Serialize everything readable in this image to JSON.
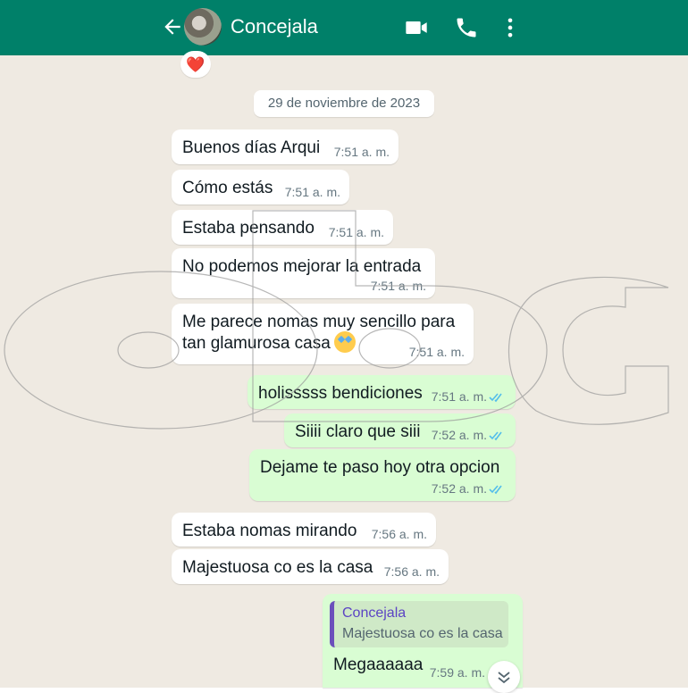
{
  "header": {
    "contact_name": "Concejala",
    "colors": {
      "bar": "#008069",
      "text": "#ffffff"
    },
    "icons": [
      "back-arrow-icon",
      "video-call-icon",
      "voice-call-icon",
      "more-options-icon"
    ]
  },
  "date_separator": "29 de noviembre de 2023",
  "reaction": "❤️",
  "messages": [
    {
      "text": "Buenos días Arqui",
      "time": "7:51 a. m."
    },
    {
      "text": "Cómo estás",
      "time": "7:51 a. m."
    },
    {
      "text": "Estaba pensando",
      "time": "7:51 a. m."
    },
    {
      "text": "No podemos mejorar la entrada",
      "time": "7:51 a. m."
    },
    {
      "text_line1": "Me parece nomas muy sencillo para",
      "text_line2": "tan glamurosa casa",
      "time": "7:51 a. m."
    },
    {
      "text": "holisssss bendiciones",
      "time": "7:51 a. m."
    },
    {
      "text": "Siiii claro que siii",
      "time": "7:52 a. m."
    },
    {
      "text": "Dejame te paso hoy otra opcion",
      "time": "7:52 a. m."
    },
    {
      "text": "Estaba nomas mirando",
      "time": "7:56 a. m."
    },
    {
      "text": "Majestuosa co es la casa",
      "time": "7:56 a. m."
    },
    {
      "quote_author": "Concejala",
      "quote_text": "Majestuosa co es la casa",
      "text": "Megaaaaaa",
      "time": "7:59 a. m."
    }
  ],
  "theme": {
    "incoming_bubble": "#ffffff",
    "outgoing_bubble": "#d9fdd3",
    "chat_background": "#efeae2",
    "read_ticks": "#53bdeb",
    "quote_accent": "#6b4fbb"
  }
}
